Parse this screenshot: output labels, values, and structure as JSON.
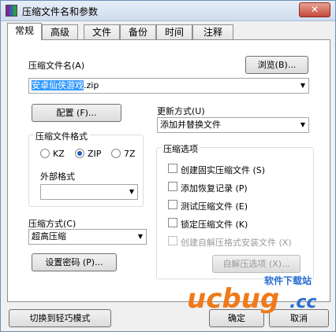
{
  "window": {
    "title": "压缩文件名和参数",
    "close_glyph": "✕"
  },
  "tabs": [
    "常规",
    "高级",
    "文件",
    "备份",
    "时间",
    "注释"
  ],
  "archive": {
    "label": "压缩文件名(A)",
    "browse_button": "浏览(B)...",
    "filename_selected": "安卓仙侠游戏",
    "filename_ext": ".zip"
  },
  "profiles_button": "配置 (F)...",
  "update_mode": {
    "label": "更新方式(U)",
    "value": "添加并替换文件"
  },
  "format": {
    "group_title": "压缩文件格式",
    "options": [
      "KZ",
      "ZIP",
      "7Z"
    ],
    "selected": "ZIP",
    "external_label": "外部格式",
    "external_value": ""
  },
  "method": {
    "label": "压缩方式(C)",
    "value": "超高压缩"
  },
  "password_button": "设置密码 (P)...",
  "options": {
    "group_title": "压缩选项",
    "items": [
      {
        "label": "创建固实压缩文件 (S)",
        "checked": false,
        "enabled": true
      },
      {
        "label": "添加恢复记录 (P)",
        "checked": false,
        "enabled": true
      },
      {
        "label": "测试压缩文件 (E)",
        "checked": false,
        "enabled": true
      },
      {
        "label": "锁定压缩文件 (K)",
        "checked": false,
        "enabled": true
      },
      {
        "label": "创建自解压格式安装文件 (X)",
        "checked": false,
        "enabled": false
      }
    ],
    "sfx_button": "自解压选项 (X)..."
  },
  "footer": {
    "switch_button": "切换到轻巧模式",
    "ok": "确定",
    "cancel": "取消"
  },
  "watermark": {
    "top": "软件下载站",
    "main": "ucbug",
    "suffix": ".cc"
  },
  "colors": {
    "accent": "#1f5fb8",
    "selection": "#3399ff",
    "watermark_orange": "#f07a1a",
    "watermark_blue": "#2a6fd0"
  }
}
